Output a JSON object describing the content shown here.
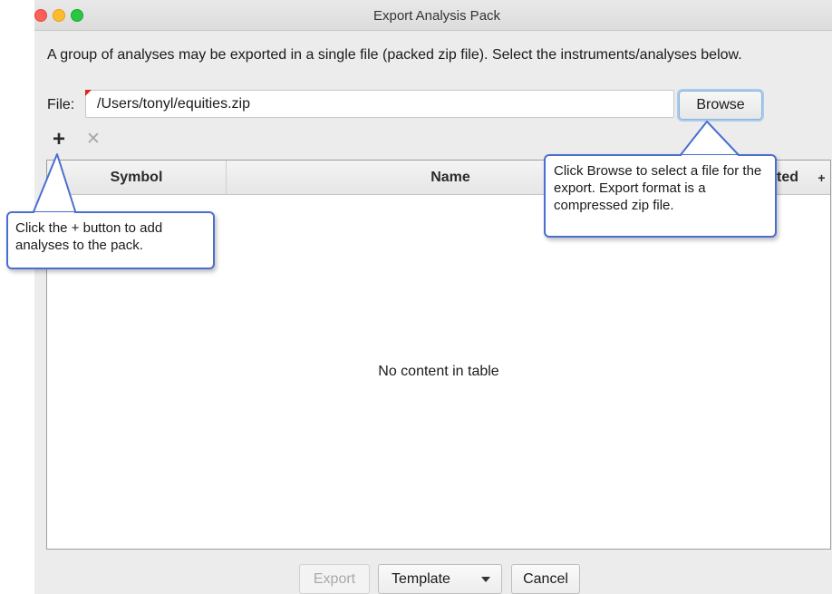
{
  "window": {
    "title": "Export Analysis Pack"
  },
  "description": "A group of analyses may be exported in a single file (packed zip file). Select the instruments/analyses below.",
  "file": {
    "label": "File:",
    "value": "/Users/tonyl/equities.zip",
    "browse_label": "Browse"
  },
  "toolbar": {
    "add_symbol": "+",
    "remove_symbol": "✕"
  },
  "table": {
    "columns": [
      "Symbol",
      "Name",
      "ted",
      "+"
    ],
    "empty_message": "No content in table"
  },
  "footer": {
    "export_label": "Export",
    "template_label": "Template",
    "cancel_label": "Cancel"
  },
  "callouts": {
    "browse_tip": "Click Browse to select a file for the export.  Export format is a compressed zip file.",
    "plus_tip": "Click the + button to add analyses to the pack."
  },
  "colors": {
    "close": "#fe5f57",
    "minimize": "#febc2e",
    "maximize": "#28c840",
    "callout_border": "#4a6fd0",
    "focus_ring": "#a9cbef"
  }
}
